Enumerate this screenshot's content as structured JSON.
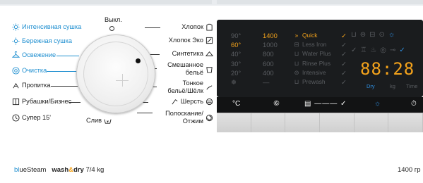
{
  "programs_left": [
    {
      "label": "Интенсивная сушка",
      "icon": "sun-steam-icon",
      "accent": true
    },
    {
      "label": "Бережная сушка",
      "icon": "sun-steam-icon",
      "accent": true
    },
    {
      "label": "Освежение",
      "icon": "hanger-steam-icon",
      "accent": true
    },
    {
      "label": "Очистка",
      "icon": "drum-clean-icon",
      "accent": true
    },
    {
      "label": "Пропитка",
      "icon": "spray-icon",
      "accent": false
    },
    {
      "label": "Рубашки/Бизнес",
      "icon": "shirt-icon",
      "accent": false
    },
    {
      "label": "Супер 15'",
      "icon": "clock-icon",
      "accent": false
    }
  ],
  "programs_right": [
    {
      "label": "Выкл."
    },
    {
      "label": "Хлопок"
    },
    {
      "label": "Хлопок Эко"
    },
    {
      "label": "Синтетика"
    },
    {
      "label": "Смешанное\nбельё"
    },
    {
      "label": "Тонкое\nбельё/Шёлк"
    },
    {
      "label": "Шерсть"
    },
    {
      "label": "Полоскание/\nОтжим"
    }
  ],
  "drain_label": "Слив",
  "temps": [
    "90°",
    "60°",
    "40°",
    "30°",
    "20°",
    "❄"
  ],
  "temps_active_index": 1,
  "speeds": [
    "1400",
    "1000",
    "800",
    "600",
    "400",
    "—"
  ],
  "speeds_active_index": 0,
  "options": [
    "Quick",
    "Less Iron",
    "Water Plus",
    "Rinse Plus",
    "Intensive",
    "Prewash"
  ],
  "options_active_index": 0,
  "display_digits": "88:28",
  "units": {
    "dry": "Dry",
    "kg": "kg",
    "time": "Time"
  },
  "buttons": {
    "temp": "°C",
    "spin": "⑥",
    "options": "▤ ——— ✓",
    "drying": "☼",
    "timer": "⏱"
  },
  "brand": {
    "blue": "bl",
    "rest": "ueSteam",
    "wash": "wash",
    "amp": "&",
    "dry": "dry",
    "capacity": "7/4 kg"
  },
  "rpm_text": "1400 гр",
  "colors": {
    "accent_blue": "#1f8fd0",
    "accent_orange": "#f3a21b",
    "panel": "#1a1c1e"
  }
}
